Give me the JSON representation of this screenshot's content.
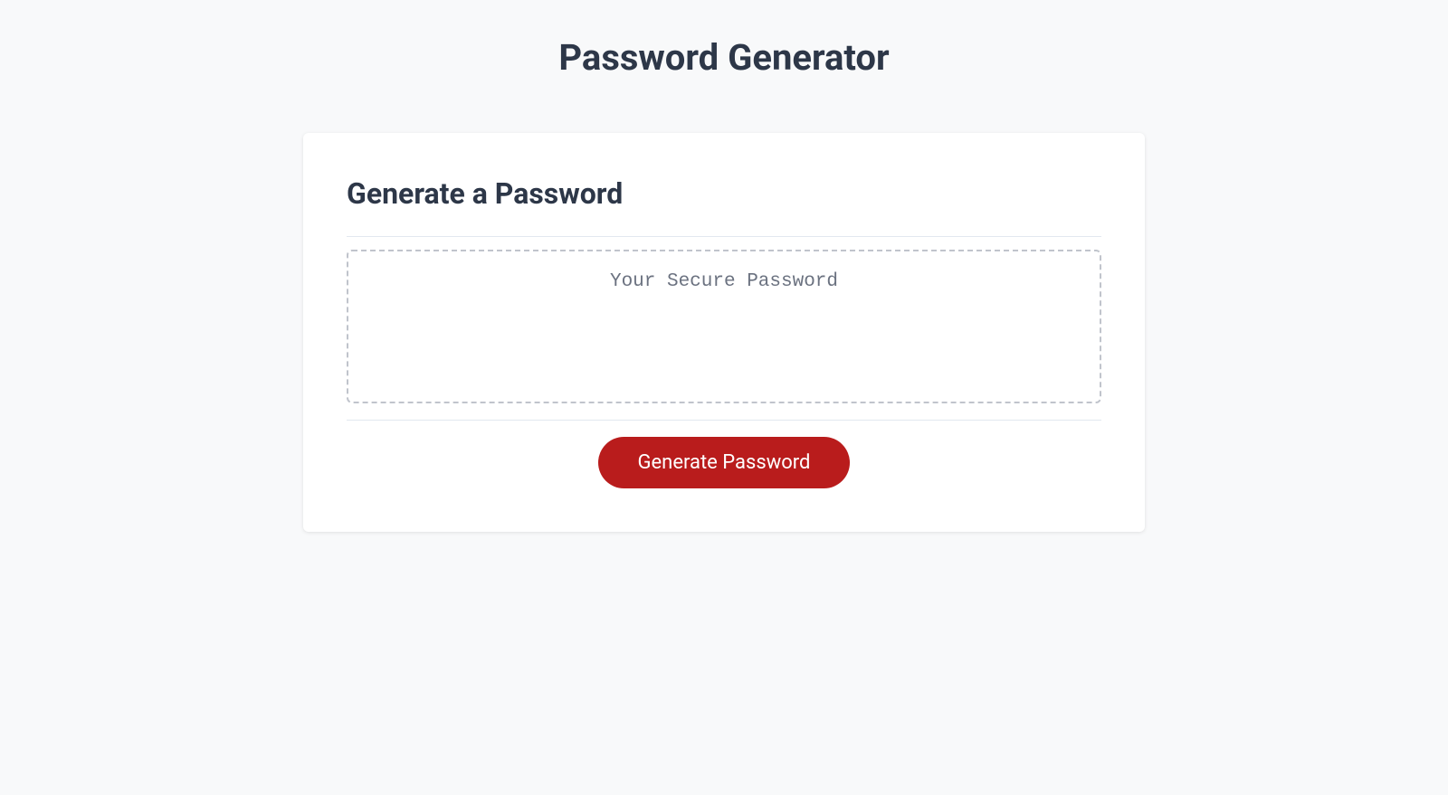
{
  "header": {
    "title": "Password Generator"
  },
  "card": {
    "heading": "Generate a Password",
    "output": {
      "placeholder": "Your Secure Password",
      "value": ""
    },
    "button_label": "Generate Password"
  }
}
